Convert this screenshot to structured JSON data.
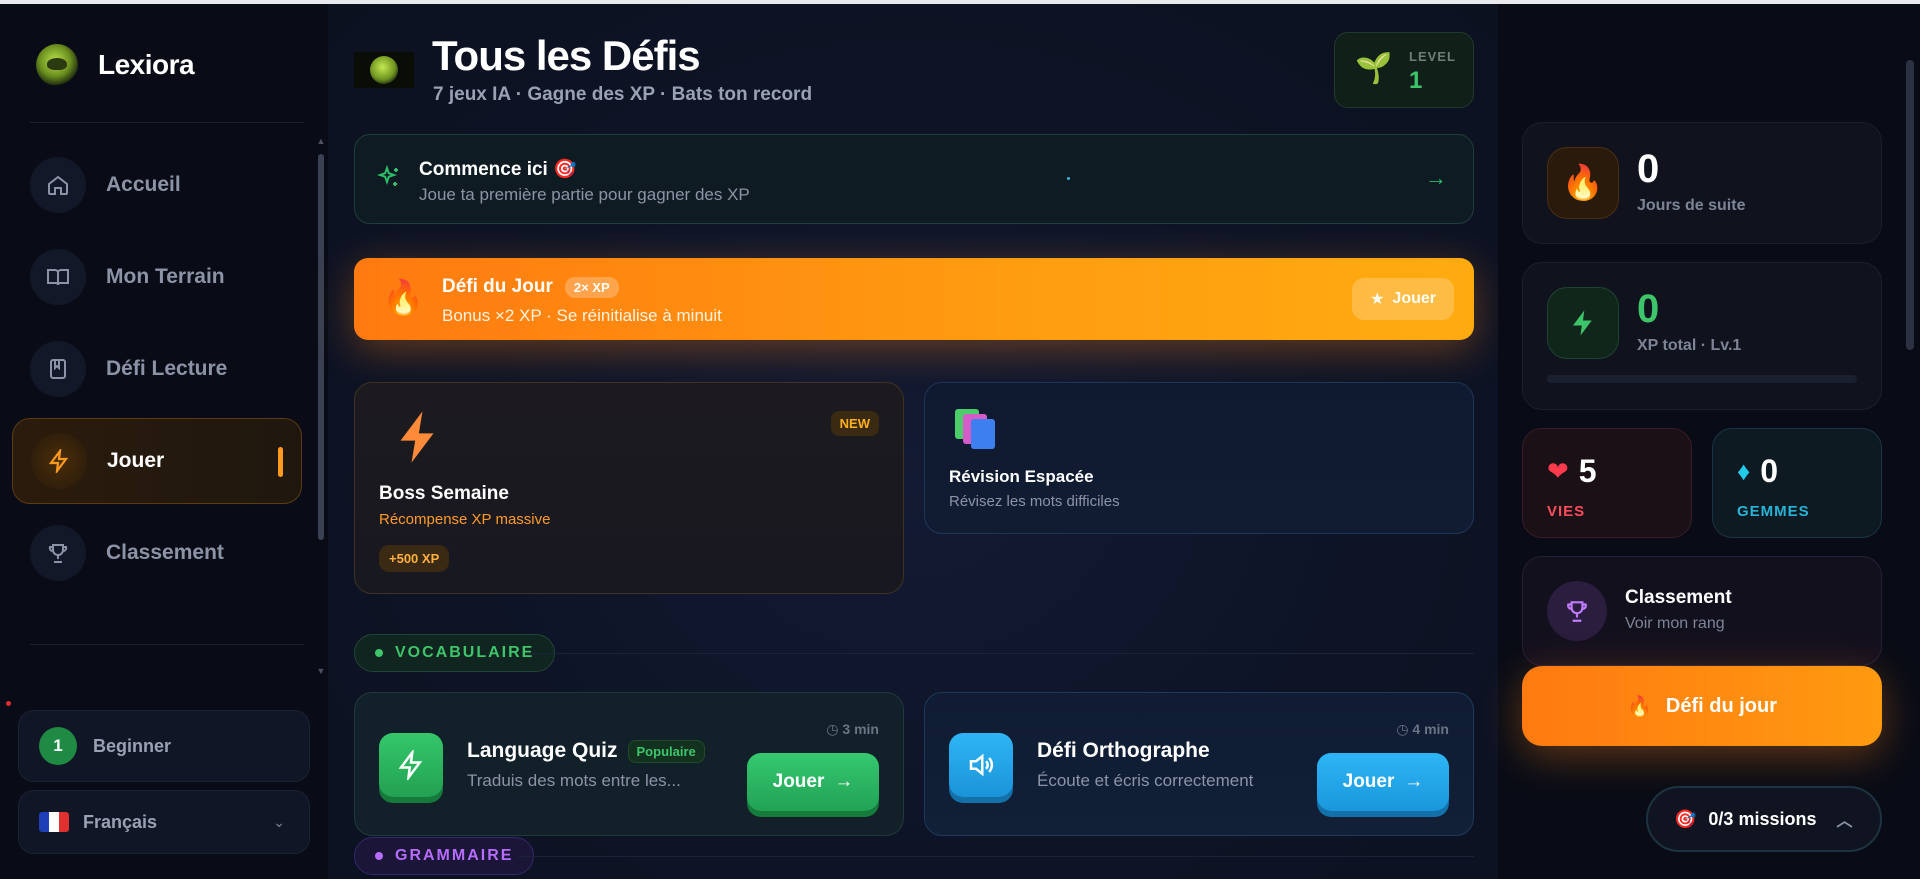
{
  "sidebar": {
    "brand": "Lexiora",
    "items": [
      {
        "label": "Accueil",
        "icon": "home-icon"
      },
      {
        "label": "Mon Terrain",
        "icon": "book-open-icon"
      },
      {
        "label": "Défi Lecture",
        "icon": "book-icon"
      },
      {
        "label": "Jouer",
        "icon": "lightning-icon",
        "active": true
      },
      {
        "label": "Classement",
        "icon": "trophy-icon"
      }
    ],
    "level_number": "1",
    "level_label": "Beginner",
    "language": "Français"
  },
  "header": {
    "title": "Tous les Défis",
    "subtitle": "7 jeux IA · Gagne des XP · Bats ton record",
    "level_caption": "LEVEL",
    "level_value": "1"
  },
  "start": {
    "title": "Commence ici 🎯",
    "subtitle": "Joue ta première partie pour gagner des XP"
  },
  "daily": {
    "title": "Défi du Jour",
    "chip": "2× XP",
    "subtitle": "Bonus ×2 XP · Se réinitialise à minuit",
    "button": "Jouer"
  },
  "boss": {
    "badge": "NEW",
    "title": "Boss Semaine",
    "subtitle": "Récompense XP massive",
    "xp": "+500 XP"
  },
  "revision": {
    "title": "Révision Espacée",
    "subtitle": "Révisez les mots difficiles"
  },
  "sections": {
    "vocab": "VOCABULAIRE",
    "grammar": "GRAMMAIRE"
  },
  "games": [
    {
      "title": "Language Quiz",
      "chip": "Populaire",
      "subtitle": "Traduis des mots entre les...",
      "time": "3 min",
      "button": "Jouer"
    },
    {
      "title": "Défi Orthographe",
      "subtitle": "Écoute et écris correctement",
      "time": "4 min",
      "button": "Jouer"
    }
  ],
  "right": {
    "streak_value": "0",
    "streak_label": "Jours de suite",
    "xp_value": "0",
    "xp_label": "XP total · Lv.1",
    "xp_progress": 0,
    "lives_value": "5",
    "lives_label": "VIES",
    "gems_value": "0",
    "gems_label": "GEMMES",
    "rank_title": "Classement",
    "rank_sub": "Voir mon rang",
    "daily_button": "Défi du jour",
    "missions": "0/3 missions"
  },
  "colors": {
    "accent_orange": "#ff8a10",
    "accent_green": "#3ec46a",
    "accent_blue": "#1fa8f0",
    "accent_purple": "#b56cff"
  }
}
